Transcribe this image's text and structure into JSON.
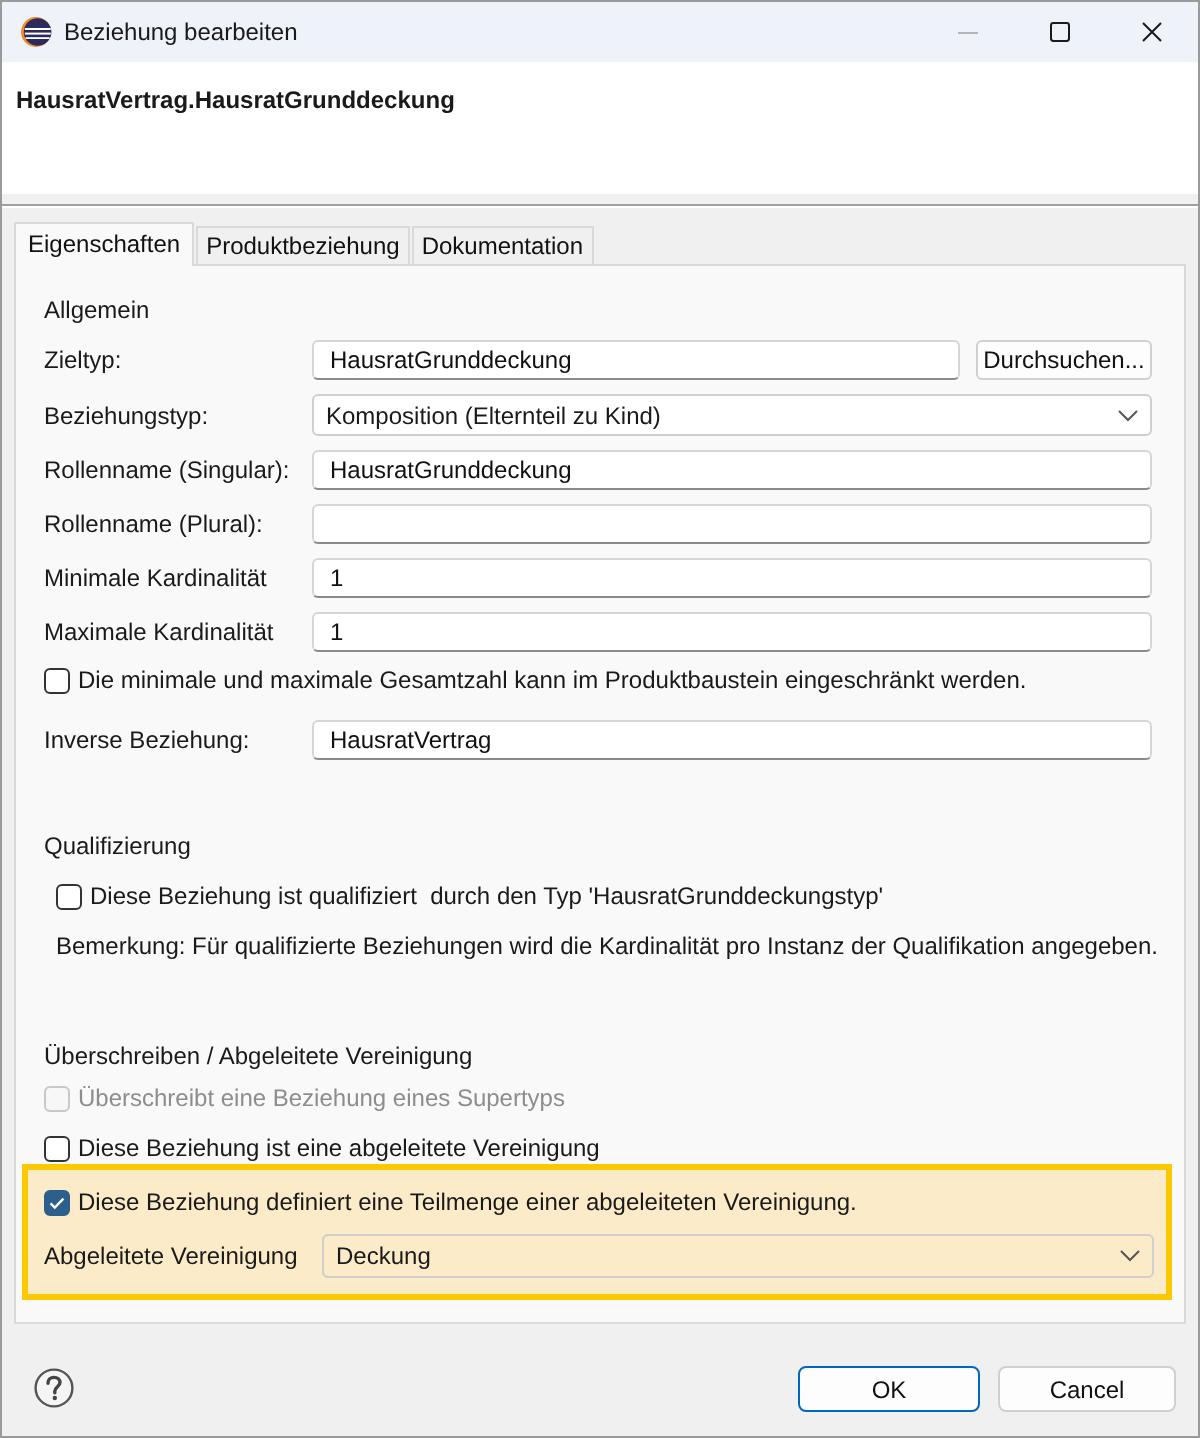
{
  "window": {
    "title": "Beziehung bearbeiten"
  },
  "header": {
    "title": "HausratVertrag.HausratGrunddeckung"
  },
  "tabs": [
    {
      "label": "Eigenschaften",
      "selected": true
    },
    {
      "label": "Produktbeziehung",
      "selected": false
    },
    {
      "label": "Dokumentation",
      "selected": false
    }
  ],
  "sections": [
    {
      "title": "Allgemein",
      "rows": [
        {
          "kind": "text",
          "label": "Zieltyp:",
          "value": "HausratGrunddeckung",
          "button": "Durchsuchen..."
        },
        {
          "kind": "combo",
          "label": "Beziehungstyp:",
          "value": "Komposition (Elternteil zu Kind)"
        },
        {
          "kind": "text",
          "label": "Rollenname (Singular):",
          "value": "HausratGrunddeckung"
        },
        {
          "kind": "text",
          "label": "Rollenname (Plural):"
        },
        {
          "kind": "text",
          "label": "Minimale Kardinalität",
          "value": "1"
        },
        {
          "kind": "text",
          "label": "Maximale Kardinalität",
          "value": "1"
        },
        {
          "kind": "checkbox",
          "label": "Die minimale und maximale Gesamtzahl kann im Produktbaustein eingeschränkt werden.",
          "checked": false,
          "disabled": false
        },
        {
          "kind": "text",
          "label": "Inverse Beziehung:",
          "value": "HausratVertrag"
        }
      ]
    },
    {
      "title": "Qualifizierung",
      "rows": [
        {
          "kind": "checkbox",
          "label": "Diese Beziehung ist qualifiziert  durch den Typ 'HausratGrunddeckungstyp'",
          "checked": false,
          "disabled": false
        },
        {
          "kind": "note",
          "text": "Bemerkung: Für qualifizierte Beziehungen wird die Kardinalität pro Instanz der Qualifikation angegeben."
        }
      ]
    },
    {
      "title": "Überschreiben / Abgeleitete Vereinigung",
      "rows": [
        {
          "kind": "checkbox",
          "label": "Überschreibt eine Beziehung eines Supertyps",
          "checked": false,
          "disabled": true
        },
        {
          "kind": "checkbox",
          "label": "Diese Beziehung ist eine abgeleitete Vereinigung",
          "checked": false,
          "disabled": false
        },
        {
          "kind": "group",
          "highlighted": true,
          "rows": [
            {
              "kind": "checkbox",
              "label": "Diese Beziehung definiert eine Teilmenge einer abgeleiteten Vereinigung.",
              "checked": true,
              "disabled": false
            },
            {
              "kind": "combo",
              "label": "Abgeleitete Vereinigung",
              "value": "Deckung"
            }
          ]
        }
      ]
    }
  ],
  "buttons": [
    {
      "label": "OK",
      "default": true
    },
    {
      "label": "Cancel",
      "default": false
    }
  ]
}
